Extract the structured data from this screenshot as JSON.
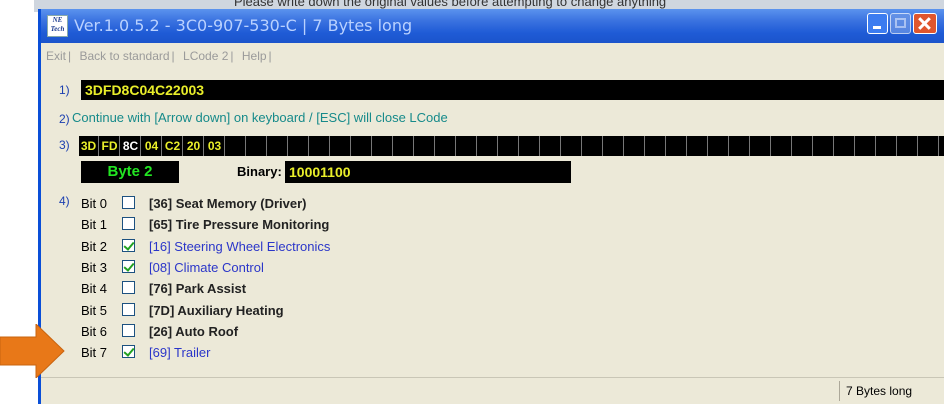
{
  "background_text": "Please write down the original values before attempting to change anything",
  "window": {
    "app_icon_text": "NE Tech",
    "title": "Ver.1.0.5.2 -  3C0-907-530-C | 7 Bytes long",
    "buttons": {
      "minimize": "minimize",
      "maximize": "maximize",
      "close": "close"
    }
  },
  "menu": [
    "Exit",
    "Back to standard",
    "LCode 2",
    "Help"
  ],
  "row1": {
    "number": "1)",
    "lcode": "3DFD8C04C22003"
  },
  "row2": {
    "number": "2)",
    "hint": "Continue with [Arrow down] on keyboard / [ESC] will close LCode"
  },
  "row3": {
    "number": "3)",
    "bytes": [
      "3D",
      "FD",
      "8C",
      "04",
      "C2",
      "20",
      "03"
    ],
    "selected_index": 2,
    "empty_cells": 35,
    "byte_label": "Byte 2",
    "binary_label": "Binary:",
    "binary_value": "10001100"
  },
  "row4": {
    "number": "4)",
    "bits": [
      {
        "name": "Bit 0",
        "checked": false,
        "label": "[36] Seat Memory (Driver)"
      },
      {
        "name": "Bit 1",
        "checked": false,
        "label": "[65] Tire Pressure Monitoring"
      },
      {
        "name": "Bit 2",
        "checked": true,
        "label": "[16] Steering Wheel Electronics"
      },
      {
        "name": "Bit 3",
        "checked": true,
        "label": "[08] Climate Control"
      },
      {
        "name": "Bit 4",
        "checked": false,
        "label": "[76] Park Assist"
      },
      {
        "name": "Bit 5",
        "checked": false,
        "label": "[7D] Auxiliary Heating"
      },
      {
        "name": "Bit 6",
        "checked": false,
        "label": "[26] Auto Roof"
      },
      {
        "name": "Bit 7",
        "checked": true,
        "label": "[69] Trailer"
      }
    ]
  },
  "status": {
    "text": "7 Bytes long"
  },
  "colors": {
    "titlebar": "#1f5bd6",
    "field_bg": "#000000",
    "field_text": "#e9ee2a",
    "byte_label": "#22e622",
    "hint": "#168a8a",
    "checked_label": "#2b36c9",
    "arrow": "#e87818"
  },
  "annotation": {
    "arrow_icon": "orange-right-arrow-icon",
    "points_to": "Bit 7"
  }
}
